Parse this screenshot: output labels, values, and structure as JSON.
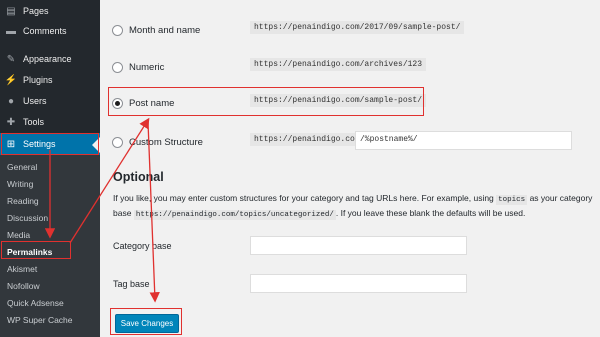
{
  "sidebar": {
    "items": [
      {
        "label": "Pages",
        "icon": "pages-icon"
      },
      {
        "label": "Comments",
        "icon": "comments-icon"
      },
      {
        "label": "Appearance",
        "icon": "appearance-icon"
      },
      {
        "label": "Plugins",
        "icon": "plugins-icon"
      },
      {
        "label": "Users",
        "icon": "users-icon"
      },
      {
        "label": "Tools",
        "icon": "tools-icon"
      },
      {
        "label": "Settings",
        "icon": "settings-icon"
      }
    ],
    "submenu": [
      "General",
      "Writing",
      "Reading",
      "Discussion",
      "Media",
      "Permalinks",
      "Akismet",
      "Nofollow",
      "Quick Adsense",
      "WP Super Cache"
    ],
    "active_color": "#0073aa"
  },
  "permalinks": {
    "options": [
      {
        "label": "Month and name",
        "example": "https://penaindigo.com/2017/09/sample-post/",
        "checked": false
      },
      {
        "label": "Numeric",
        "example": "https://penaindigo.com/archives/123",
        "checked": false
      },
      {
        "label": "Post name",
        "example": "https://penaindigo.com/sample-post/",
        "checked": true
      },
      {
        "label": "Custom Structure",
        "example": "https://penaindigo.com",
        "value": "/%postname%/",
        "checked": false
      }
    ]
  },
  "optional": {
    "heading": "Optional",
    "desc_part1": "If you like, you may enter custom structures for your category and tag URLs here. For example, using",
    "desc_code1": "topics",
    "desc_part2": "as your category base",
    "desc_code2": "https://penaindigo.com/topics/uncategorized/",
    "desc_part3": ". If you leave these blank the defaults will be used.",
    "category_base_label": "Category base",
    "category_base_value": "",
    "tag_base_label": "Tag base",
    "tag_base_value": ""
  },
  "save_button_label": "Save Changes",
  "highlight_color": "#e0312f"
}
